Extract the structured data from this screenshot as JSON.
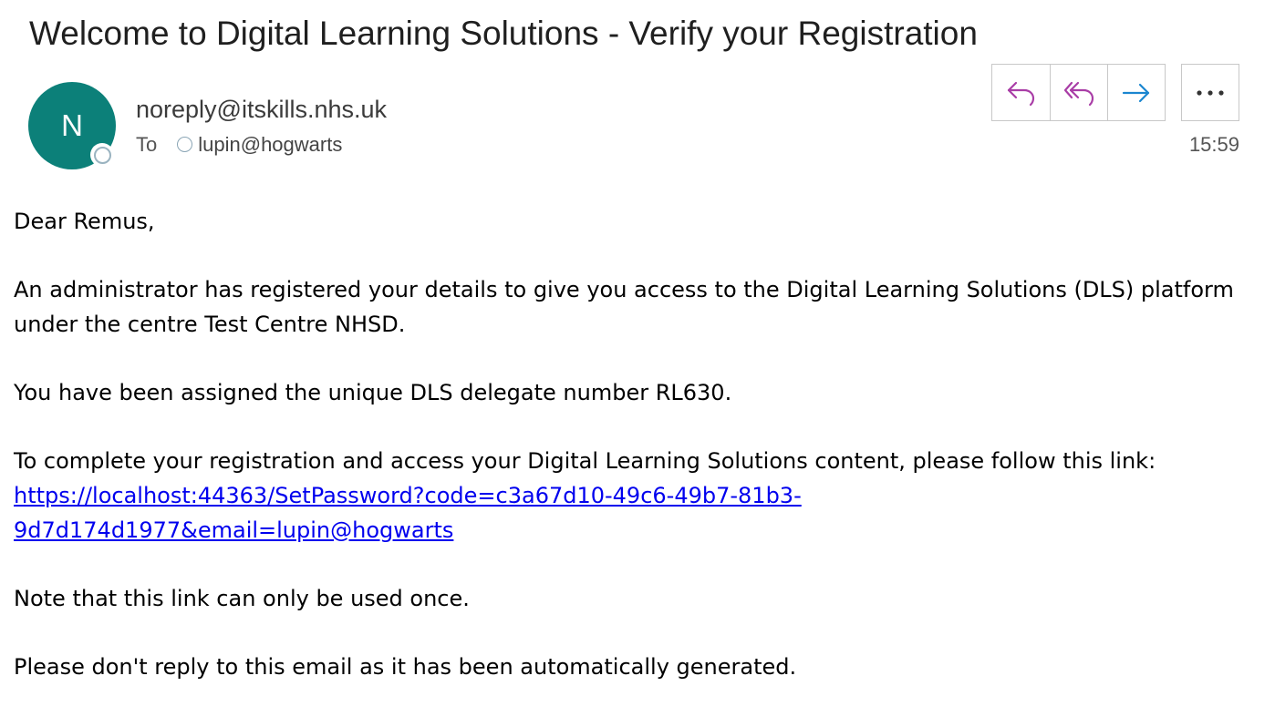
{
  "email": {
    "subject": "Welcome to Digital Learning Solutions - Verify your Registration",
    "avatar_initial": "N",
    "sender": "noreply@itskills.nhs.uk",
    "to_label": "To",
    "recipient": "lupin@hogwarts",
    "time": "15:59",
    "body": {
      "greeting": "Dear Remus,",
      "paragraph_1": "An administrator has registered your details to give you access to the Digital Learning Solutions (DLS) platform under the centre Test Centre NHSD.",
      "paragraph_2": "You have been assigned the unique DLS delegate number RL630.",
      "paragraph_3": "To complete your registration and access your Digital Learning Solutions content, please follow this link:",
      "link_line_1": "https://localhost:44363/SetPassword?code=c3a67d10-49c6-49b7-81b3-",
      "link_line_2": "9d7d174d1977&email=lupin@hogwarts",
      "paragraph_4": "Note that this link can only be used once.",
      "paragraph_5": "Please don't reply to this email as it has been automatically generated."
    }
  },
  "actions": {
    "reply_icon": "reply-icon",
    "reply_all_icon": "reply-all-icon",
    "forward_icon": "forward-icon",
    "more_icon": "more-icon"
  },
  "colors": {
    "avatar": "#0c8079",
    "reply": "#a93da6",
    "forward": "#1a86d0",
    "link": "#0000ee"
  }
}
